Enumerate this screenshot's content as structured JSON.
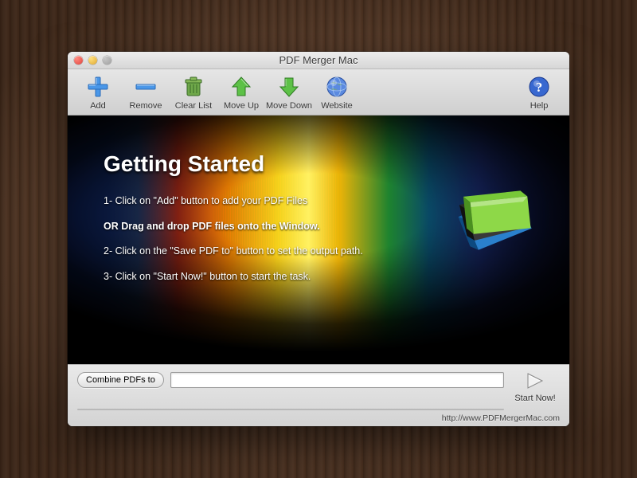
{
  "window": {
    "title": "PDF Merger Mac"
  },
  "toolbar": {
    "add": "Add",
    "remove": "Remove",
    "clear_list": "Clear List",
    "move_up": "Move Up",
    "move_down": "Move Down",
    "website": "Website",
    "help": "Help"
  },
  "content": {
    "heading": "Getting Started",
    "step1": "1- Click on \"Add\" button to add your PDF Files",
    "or_line": "OR Drag and drop PDF files onto the Window.",
    "step2": "2- Click on the \"Save PDF to\" button to set the output path.",
    "step3": "3- Click on \"Start Now!\" button to start the task."
  },
  "bottom": {
    "combine_label": "Combine PDFs to",
    "path_value": "",
    "start_label": "Start Now!",
    "url": "http://www.PDFMergerMac.com"
  },
  "icons": {
    "add": "plus-icon",
    "remove": "minus-icon",
    "clear": "trash-icon",
    "up": "arrow-up-icon",
    "down": "arrow-down-icon",
    "website": "globe-icon",
    "help": "help-icon",
    "start": "play-icon"
  },
  "colors": {
    "add": "#3d8ee8",
    "remove": "#3d8ee8",
    "up": "#4db33a",
    "down": "#4db33a",
    "globe": "#3d6fd8",
    "help": "#2a60d0"
  }
}
